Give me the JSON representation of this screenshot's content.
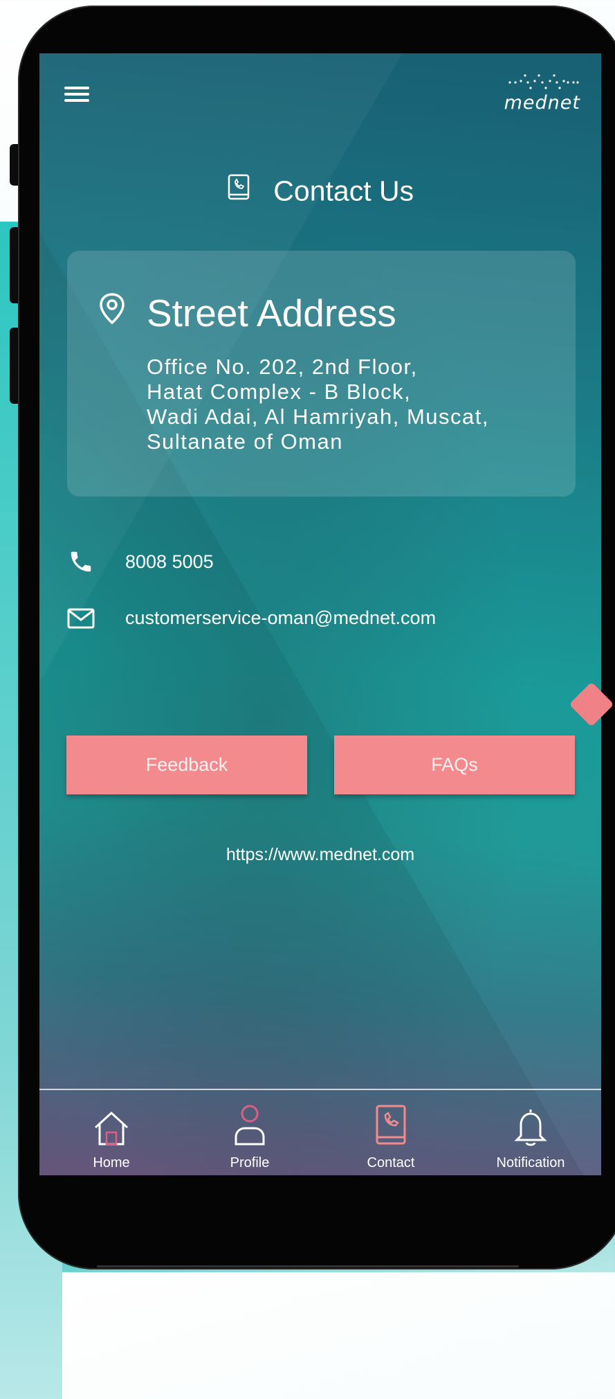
{
  "app": {
    "logo_text": "mednet",
    "logo_icon": "mednet-dots-logo"
  },
  "header": {
    "menu_icon": "hamburger-menu-icon",
    "title": "Contact Us",
    "title_icon": "phone-book-icon"
  },
  "address": {
    "icon": "location-pin-icon",
    "heading": "Street Address",
    "lines": [
      "Office No. 202, 2nd Floor,",
      "Hatat Complex - B Block,",
      "Wadi Adai, Al Hamriyah, Muscat,",
      "Sultanate of Oman"
    ]
  },
  "contacts": {
    "phone": "8008 5005",
    "email": "customerservice-oman@mednet.com"
  },
  "buttons": {
    "feedback": "Feedback",
    "faqs": "FAQs"
  },
  "website": "https://www.mednet.com",
  "nav": [
    {
      "label": "Home",
      "icon": "home-icon"
    },
    {
      "label": "Profile",
      "icon": "profile-icon"
    },
    {
      "label": "Contact",
      "icon": "contact-book-icon"
    },
    {
      "label": "Notification",
      "icon": "bell-icon"
    }
  ],
  "colors": {
    "accent": "#f28a8e",
    "screen_top": "#185f73",
    "screen_mid": "#1a9a99",
    "screen_bottom": "#6e5a82",
    "contact_icon_active": "#f28a8e"
  }
}
